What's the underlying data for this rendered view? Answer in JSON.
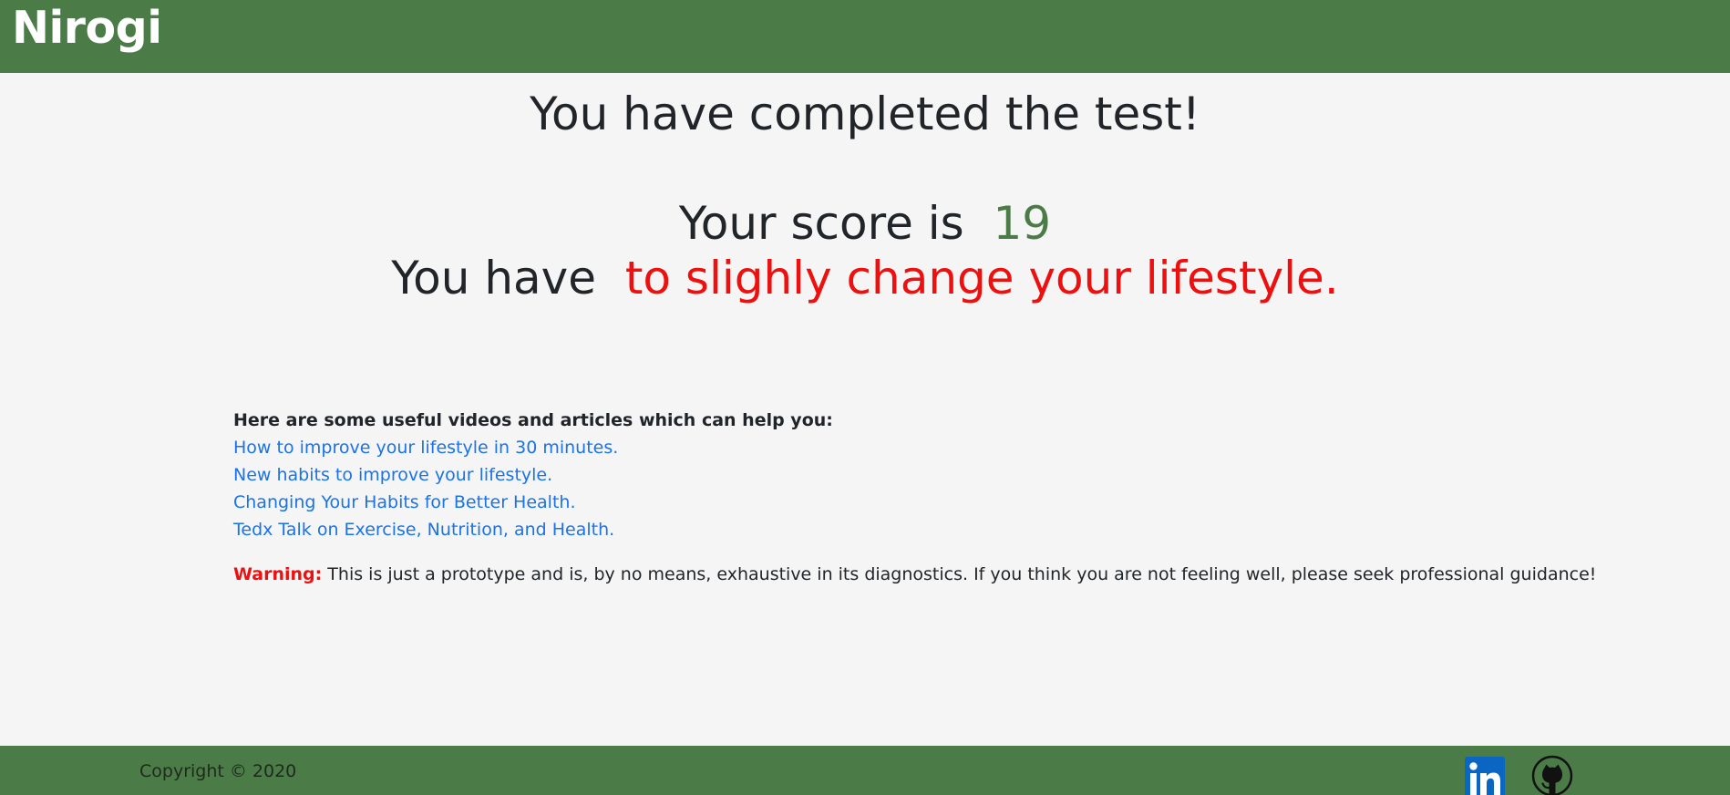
{
  "header": {
    "brand": "Nirogi"
  },
  "result": {
    "title": "You have completed the test!",
    "score_prefix": "Your score is",
    "score_value": "19",
    "verdict_prefix": "You have",
    "verdict_value": "to slighly change your lifestyle."
  },
  "resources": {
    "heading": "Here are some useful videos and articles which can help you:",
    "links": [
      "How to improve your lifestyle in 30 minutes.",
      "New habits to improve your lifestyle.",
      "Changing Your Habits for Better Health.",
      "Tedx Talk on Exercise, Nutrition, and Health."
    ]
  },
  "warning": {
    "label": "Warning:",
    "text": "This is just a prototype and is, by no means, exhaustive in its diagnostics. If you think you are not feeling well, please seek professional guidance!"
  },
  "footer": {
    "copyright": "Copyright © 2020",
    "icons": [
      "linkedin-icon",
      "github-icon"
    ]
  },
  "colors": {
    "brand_green": "#4b7b47",
    "score_green": "#4b7b47",
    "alert_red": "#ee0f0f",
    "link_blue": "#1a73e8",
    "background": "#f5f5f5"
  }
}
